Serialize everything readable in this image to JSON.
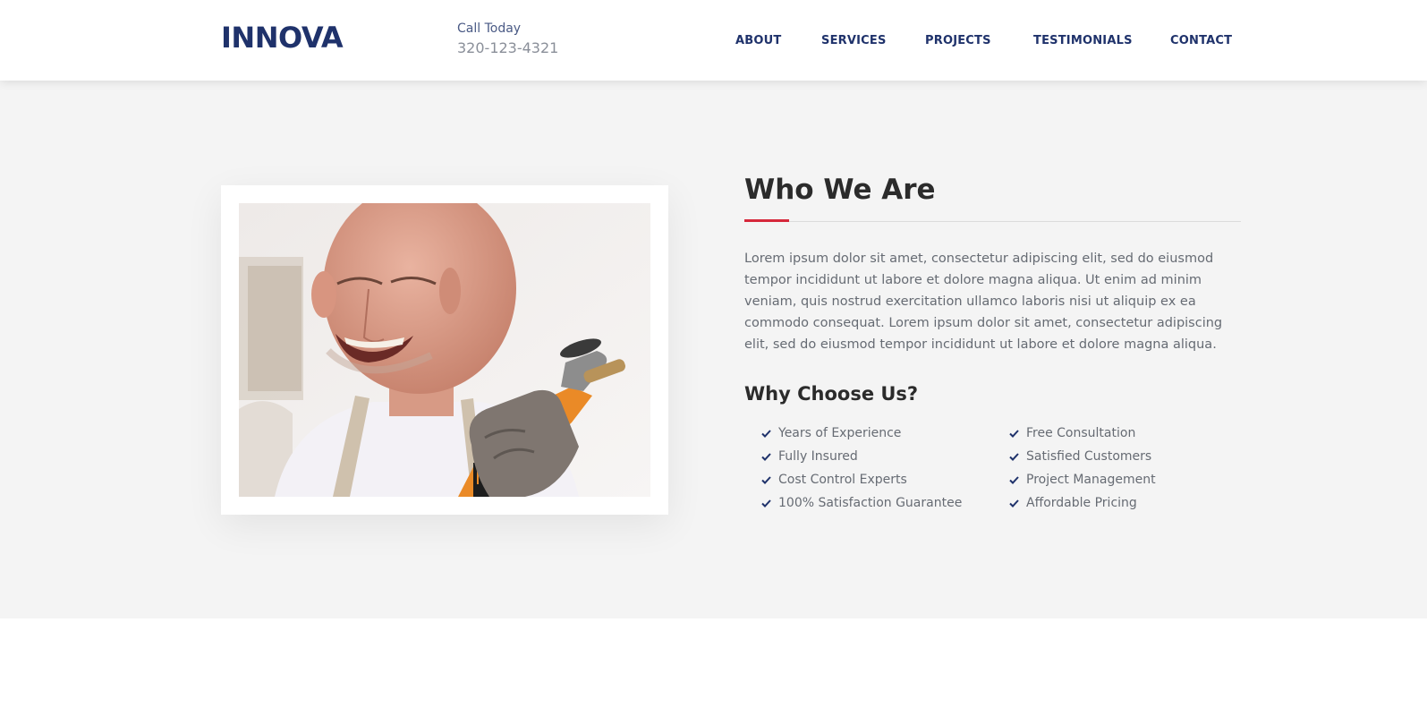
{
  "header": {
    "logo": "INNOVA",
    "call_label": "Call Today",
    "phone": "320-123-4321",
    "nav": [
      "ABOUT",
      "SERVICES",
      "PROJECTS",
      "TESTIMONIALS",
      "CONTACT"
    ]
  },
  "about": {
    "heading": "Who We Are",
    "body": "Lorem ipsum dolor sit amet, consectetur adipiscing elit, sed do eiusmod tempor incididunt ut labore et dolore magna aliqua. Ut enim ad minim veniam, quis nostrud exercitation ullamco laboris nisi ut aliquip ex ea commodo consequat. Lorem ipsum dolor sit amet, consectetur adipiscing elit, sed do eiusmod tempor incididunt ut labore et dolore magna aliqua.",
    "why_heading": "Why Choose Us?",
    "why_left": [
      "Years of Experience",
      "Fully Insured",
      "Cost Control Experts",
      "100% Satisfaction Guarantee"
    ],
    "why_right": [
      "Free Consultation",
      "Satisfied Customers",
      "Project Management",
      "Affordable Pricing"
    ]
  },
  "colors": {
    "brand": "#1f326b",
    "accent": "#d6283b",
    "section_bg": "#f4f4f4"
  },
  "icons": {
    "check": "check-icon",
    "photo": "worker-with-grinder-photo"
  }
}
